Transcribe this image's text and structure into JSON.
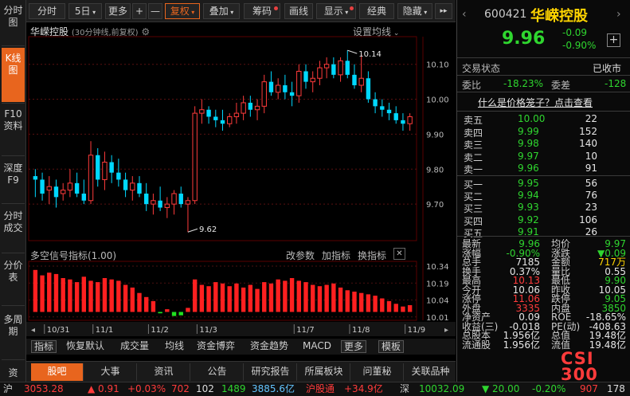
{
  "left_tabs": [
    {
      "label": "分时图",
      "active": false
    },
    {
      "label": "K线图",
      "active": true
    },
    {
      "label": "F10资料",
      "active": false
    },
    {
      "label": "深度F9",
      "active": false
    },
    {
      "label": "分时成交",
      "active": false
    },
    {
      "label": "分价表",
      "active": false
    },
    {
      "label": "多周期",
      "active": false
    },
    {
      "label": "资",
      "active": false
    }
  ],
  "toolbar": {
    "fenshi": "分时",
    "period": "5日",
    "more": "更多",
    "plus": "+",
    "minus": "—",
    "fuquan": "复权",
    "diejia": "叠加",
    "chouma": "筹码",
    "huaxian": "画线",
    "xianshi": "显示",
    "jingdian": "经典",
    "yincang": "隐藏",
    "arrow": "▸▸"
  },
  "chart_header": {
    "name": "华嵘控股",
    "info": "(30分钟线,前复权)",
    "set_ma": "设置均线"
  },
  "chart_data": [
    {
      "type": "candlestick",
      "title": "华嵘控股 (30分钟线,前复权)",
      "y_ticks": [
        "10.10",
        "10.00",
        "9.90",
        "9.80",
        "9.70"
      ],
      "ylim": [
        9.6,
        10.17
      ],
      "x_labels": [
        "10/31",
        "11/1",
        "11/2",
        "11/3",
        "11/7",
        "11/8",
        "11/9"
      ],
      "x_label_index": [
        2,
        9,
        17,
        24,
        38,
        46,
        54
      ],
      "annotations": [
        {
          "text": "10.14",
          "index": 45,
          "price": 10.14
        },
        {
          "text": "9.62",
          "index": 22,
          "price": 9.62
        }
      ],
      "candles": [
        {
          "o": 9.78,
          "h": 9.8,
          "l": 9.72,
          "c": 9.77,
          "up": false
        },
        {
          "o": 9.77,
          "h": 9.79,
          "l": 9.71,
          "c": 9.73,
          "up": false
        },
        {
          "o": 9.74,
          "h": 9.78,
          "l": 9.7,
          "c": 9.75,
          "up": true
        },
        {
          "o": 9.75,
          "h": 9.77,
          "l": 9.69,
          "c": 9.72,
          "up": false
        },
        {
          "o": 9.73,
          "h": 9.76,
          "l": 9.71,
          "c": 9.74,
          "up": true
        },
        {
          "o": 9.74,
          "h": 9.8,
          "l": 9.72,
          "c": 9.76,
          "up": true
        },
        {
          "o": 9.76,
          "h": 9.79,
          "l": 9.72,
          "c": 9.73,
          "up": false
        },
        {
          "o": 9.73,
          "h": 9.77,
          "l": 9.7,
          "c": 9.71,
          "up": false
        },
        {
          "o": 9.71,
          "h": 9.88,
          "l": 9.7,
          "c": 9.84,
          "up": true
        },
        {
          "o": 9.84,
          "h": 9.86,
          "l": 9.75,
          "c": 9.77,
          "up": false
        },
        {
          "o": 9.77,
          "h": 9.85,
          "l": 9.74,
          "c": 9.82,
          "up": true
        },
        {
          "o": 9.82,
          "h": 9.84,
          "l": 9.76,
          "c": 9.79,
          "up": false
        },
        {
          "o": 9.79,
          "h": 9.83,
          "l": 9.75,
          "c": 9.77,
          "up": false
        },
        {
          "o": 9.77,
          "h": 9.79,
          "l": 9.72,
          "c": 9.74,
          "up": false
        },
        {
          "o": 9.74,
          "h": 9.78,
          "l": 9.71,
          "c": 9.76,
          "up": true
        },
        {
          "o": 9.76,
          "h": 9.78,
          "l": 9.72,
          "c": 9.73,
          "up": false
        },
        {
          "o": 9.73,
          "h": 9.76,
          "l": 9.68,
          "c": 9.7,
          "up": false
        },
        {
          "o": 9.7,
          "h": 9.73,
          "l": 9.67,
          "c": 9.71,
          "up": true
        },
        {
          "o": 9.71,
          "h": 9.75,
          "l": 9.68,
          "c": 9.69,
          "up": false
        },
        {
          "o": 9.69,
          "h": 9.72,
          "l": 9.66,
          "c": 9.7,
          "up": true
        },
        {
          "o": 9.7,
          "h": 9.74,
          "l": 9.67,
          "c": 9.73,
          "up": true
        },
        {
          "o": 9.73,
          "h": 9.75,
          "l": 9.69,
          "c": 9.7,
          "up": false
        },
        {
          "o": 9.7,
          "h": 9.72,
          "l": 9.62,
          "c": 9.71,
          "up": true
        },
        {
          "o": 9.71,
          "h": 9.98,
          "l": 9.7,
          "c": 9.96,
          "up": true
        },
        {
          "o": 9.96,
          "h": 10.0,
          "l": 9.93,
          "c": 9.97,
          "up": true
        },
        {
          "o": 9.97,
          "h": 9.98,
          "l": 9.93,
          "c": 9.95,
          "up": false
        },
        {
          "o": 9.95,
          "h": 9.97,
          "l": 9.92,
          "c": 9.94,
          "up": false
        },
        {
          "o": 9.94,
          "h": 9.97,
          "l": 9.91,
          "c": 9.93,
          "up": false
        },
        {
          "o": 9.93,
          "h": 9.96,
          "l": 9.92,
          "c": 9.95,
          "up": true
        },
        {
          "o": 9.95,
          "h": 9.99,
          "l": 9.93,
          "c": 9.96,
          "up": true
        },
        {
          "o": 9.96,
          "h": 10.01,
          "l": 9.94,
          "c": 9.99,
          "up": true
        },
        {
          "o": 9.99,
          "h": 10.01,
          "l": 9.95,
          "c": 9.97,
          "up": false
        },
        {
          "o": 9.97,
          "h": 10.0,
          "l": 9.94,
          "c": 9.98,
          "up": true
        },
        {
          "o": 9.98,
          "h": 10.07,
          "l": 9.96,
          "c": 10.05,
          "up": true
        },
        {
          "o": 10.05,
          "h": 10.08,
          "l": 10.01,
          "c": 10.02,
          "up": false
        },
        {
          "o": 10.02,
          "h": 10.06,
          "l": 10.0,
          "c": 10.04,
          "up": true
        },
        {
          "o": 10.04,
          "h": 10.07,
          "l": 10.0,
          "c": 10.02,
          "up": false
        },
        {
          "o": 10.02,
          "h": 10.05,
          "l": 9.98,
          "c": 10.01,
          "up": false
        },
        {
          "o": 10.01,
          "h": 10.1,
          "l": 9.99,
          "c": 10.08,
          "up": true
        },
        {
          "o": 10.08,
          "h": 10.1,
          "l": 10.03,
          "c": 10.05,
          "up": false
        },
        {
          "o": 10.05,
          "h": 10.08,
          "l": 10.02,
          "c": 10.06,
          "up": true
        },
        {
          "o": 10.06,
          "h": 10.11,
          "l": 10.04,
          "c": 10.09,
          "up": true
        },
        {
          "o": 10.09,
          "h": 10.12,
          "l": 10.06,
          "c": 10.1,
          "up": true
        },
        {
          "o": 10.1,
          "h": 10.12,
          "l": 10.06,
          "c": 10.07,
          "up": false
        },
        {
          "o": 10.07,
          "h": 10.12,
          "l": 10.05,
          "c": 10.11,
          "up": true
        },
        {
          "o": 10.11,
          "h": 10.14,
          "l": 10.06,
          "c": 10.07,
          "up": false
        },
        {
          "o": 10.07,
          "h": 10.1,
          "l": 10.03,
          "c": 10.04,
          "up": false
        },
        {
          "o": 10.04,
          "h": 10.13,
          "l": 10.02,
          "c": 10.06,
          "up": true
        },
        {
          "o": 10.06,
          "h": 10.08,
          "l": 9.99,
          "c": 10.0,
          "up": false
        },
        {
          "o": 10.0,
          "h": 10.02,
          "l": 9.96,
          "c": 9.98,
          "up": false
        },
        {
          "o": 9.98,
          "h": 10.0,
          "l": 9.95,
          "c": 9.97,
          "up": false
        },
        {
          "o": 9.97,
          "h": 9.99,
          "l": 9.94,
          "c": 9.96,
          "up": false
        },
        {
          "o": 9.96,
          "h": 9.98,
          "l": 9.93,
          "c": 9.94,
          "up": false
        },
        {
          "o": 9.94,
          "h": 9.96,
          "l": 9.91,
          "c": 9.93,
          "up": false
        },
        {
          "o": 9.93,
          "h": 9.96,
          "l": 9.91,
          "c": 9.95,
          "up": true
        }
      ]
    },
    {
      "type": "bar",
      "title": "多空信号指标(1.00)",
      "y_ticks": [
        "10.34",
        "10.19",
        "10.04",
        "10.01"
      ],
      "values": [
        62,
        54,
        58,
        56,
        50,
        48,
        44,
        52,
        46,
        44,
        50,
        48,
        46,
        40,
        36,
        28,
        22,
        16,
        -2,
        4,
        -6,
        -5,
        6,
        48,
        40,
        38,
        44,
        42,
        38,
        42,
        36,
        40,
        34,
        44,
        42,
        48,
        46,
        50,
        46,
        44,
        40,
        38,
        40,
        42,
        36,
        32,
        30,
        28,
        26,
        24,
        20,
        16,
        12,
        8,
        10
      ],
      "ylim": [
        -10,
        70
      ]
    }
  ],
  "indicator_panel": {
    "title": "多空信号指标(1.00)",
    "change_params": "改参数",
    "add_indicator": "加指标",
    "switch_indicator": "换指标",
    "close": "✕"
  },
  "bottom_tabs": [
    "指标",
    "恢复默认",
    "成交量",
    "均线",
    "资金博弈",
    "资金趋势",
    "MACD",
    "更多",
    "模板"
  ],
  "news_tabs": [
    "股吧",
    "大事",
    "资讯",
    "公告",
    "研究报告",
    "所属板块",
    "问董秘",
    "关联品种"
  ],
  "right": {
    "code": "600421",
    "name": "华嵘控股",
    "price": "9.96",
    "change": "-0.09",
    "change_pct": "-0.90%",
    "status_label": "交易状态",
    "status_value": "已收市",
    "weibi_label": "委比",
    "weibi_value": "-18.23%",
    "weicha_label": "委差",
    "weicha_value": "-128",
    "cage_link": "什么是价格笼子？点击查看",
    "sells": [
      {
        "label": "卖五",
        "price": "10.00",
        "vol": "22"
      },
      {
        "label": "卖四",
        "price": "9.99",
        "vol": "152"
      },
      {
        "label": "卖三",
        "price": "9.98",
        "vol": "140"
      },
      {
        "label": "卖二",
        "price": "9.97",
        "vol": "10"
      },
      {
        "label": "卖一",
        "price": "9.96",
        "vol": "91"
      }
    ],
    "buys": [
      {
        "label": "买一",
        "price": "9.95",
        "vol": "56"
      },
      {
        "label": "买二",
        "price": "9.94",
        "vol": "76"
      },
      {
        "label": "买三",
        "price": "9.93",
        "vol": "23"
      },
      {
        "label": "买四",
        "price": "9.92",
        "vol": "106"
      },
      {
        "label": "买五",
        "price": "9.91",
        "vol": "26"
      }
    ],
    "stats": [
      {
        "l1": "最新",
        "v1": "9.96",
        "c1": "green",
        "l2": "均价",
        "v2": "9.97",
        "c2": "green"
      },
      {
        "l1": "涨幅",
        "v1": "-0.90%",
        "c1": "green",
        "l2": "涨跌",
        "v2": "▼0.09",
        "c2": "green"
      },
      {
        "l1": "总手",
        "v1": "7185",
        "c1": "white",
        "l2": "金额",
        "v2": "717万",
        "c2": "yellow"
      },
      {
        "l1": "换手",
        "v1": "0.37%",
        "c1": "white",
        "l2": "量比",
        "v2": "0.55",
        "c2": "white"
      },
      {
        "l1": "最高",
        "v1": "10.13",
        "c1": "red",
        "l2": "最低",
        "v2": "9.90",
        "c2": "green"
      },
      {
        "l1": "今开",
        "v1": "10.06",
        "c1": "white",
        "l2": "昨收",
        "v2": "10.05",
        "c2": "white"
      },
      {
        "l1": "涨停",
        "v1": "11.06",
        "c1": "red",
        "l2": "跌停",
        "v2": "9.05",
        "c2": "green"
      },
      {
        "l1": "外盘",
        "v1": "3335",
        "c1": "red",
        "l2": "内盘",
        "v2": "3850",
        "c2": "green"
      },
      {
        "l1": "净资产",
        "v1": "0.09",
        "c1": "white",
        "l2": "ROE",
        "v2": "-18.65%",
        "c2": "white"
      },
      {
        "l1": "收益(三)",
        "v1": "-0.018",
        "c1": "white",
        "l2": "PE(动)",
        "v2": "-408.63",
        "c2": "white"
      },
      {
        "l1": "总股本",
        "v1": "1.956亿",
        "c1": "white",
        "l2": "总值",
        "v2": "19.48亿",
        "c2": "white"
      },
      {
        "l1": "流通股",
        "v1": "1.956亿",
        "c1": "white",
        "l2": "流值",
        "v2": "19.48亿",
        "c2": "white"
      }
    ],
    "watermark": "CSI 300"
  },
  "status_bar": {
    "sh_label": "沪",
    "sh_index": "3053.28",
    "sh_change": "▲ 0.91",
    "sh_pct": "+0.03%",
    "sh_up": "702",
    "sh_flat": "102",
    "sh_down": "1489",
    "sh_amount": "3885.6亿",
    "hgt_label": "沪股通",
    "hgt_value": "+34.9亿",
    "sz_label": "深",
    "sz_index": "10032.09",
    "sz_change": "▼ 20.00",
    "sz_pct": "-0.20%",
    "sz_up": "907",
    "sz_flat": "178"
  },
  "colors": {
    "up": "#ff3b3b",
    "down": "#00d8ff",
    "accent": "#e8651e",
    "green": "#2fd62f"
  }
}
